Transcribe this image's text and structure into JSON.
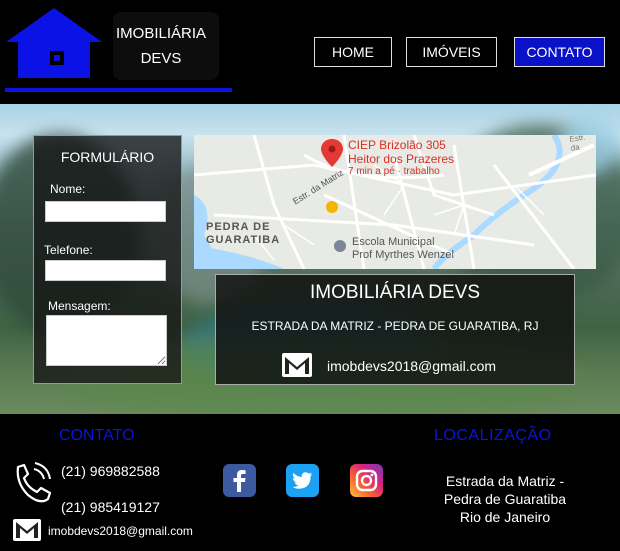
{
  "brand": {
    "line1": "IMOBILIÁRIA",
    "line2": "DEVS",
    "accent_color": "#0a12e6"
  },
  "nav": {
    "home": "HOME",
    "imoveis": "IMÓVEIS",
    "contato": "CONTATO",
    "active": "contato"
  },
  "form": {
    "title": "FORMULÁRIO",
    "nome_label": "Nome:",
    "telefone_label": "Telefone:",
    "mensagem_label": "Mensagem:",
    "nome_value": "",
    "telefone_value": "",
    "mensagem_value": ""
  },
  "map": {
    "place_name_1": "CIEP Brizolão 305",
    "place_name_2": "Heitor dos Prazeres",
    "place_sub": "7 min a pé · trabalho",
    "area_1": "PEDRA DE",
    "area_2": "GUARATIBA",
    "street_1": "Estr. da Matriz",
    "street_2": "Estr. da",
    "school_1": "Escola Municipal",
    "school_2": "Prof Myrthes Wenzel"
  },
  "info": {
    "title": "IMOBILIÁRIA DEVS",
    "address": "ESTRADA DA MATRIZ - PEDRA DE GUARATIBA, RJ",
    "email": "imobdevs2018@gmail.com",
    "mail_icon": "gmail-icon"
  },
  "footer": {
    "contato_heading": "CONTATO",
    "localizacao_heading": "LOCALIZAÇÃO",
    "heading_color": "#0a14e0",
    "phone_1": "(21) 969882588",
    "phone_2": "(21) 985419127",
    "email": "imobdevs2018@gmail.com",
    "location_1": "Estrada da Matriz -",
    "location_2": "Pedra de Guaratiba",
    "location_3": "Rio de Janeiro",
    "social": [
      "facebook-icon",
      "twitter-icon",
      "instagram-icon"
    ]
  }
}
